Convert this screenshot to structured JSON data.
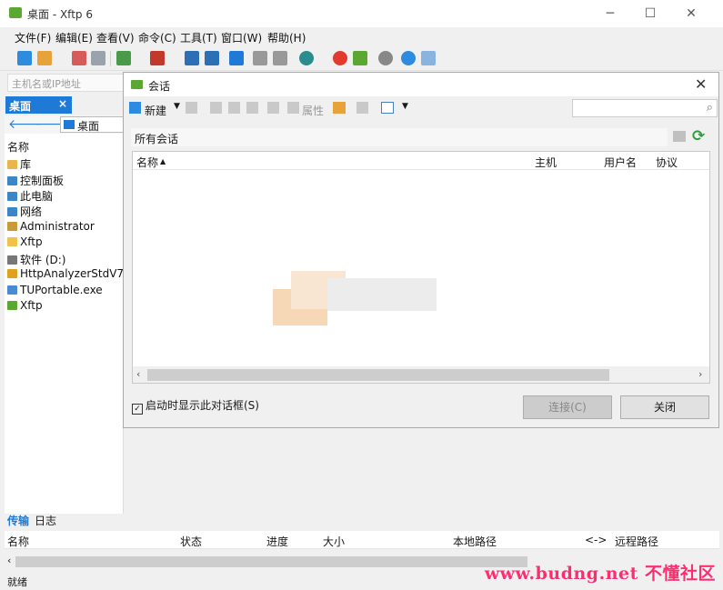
{
  "window": {
    "title": "桌面 - Xftp 6"
  },
  "menus": [
    "文件(F)",
    "编辑(E)",
    "查看(V)",
    "命令(C)",
    "工具(T)",
    "窗口(W)",
    "帮助(H)"
  ],
  "host_placeholder": "主机名或IP地址",
  "left_tab": {
    "label": "桌面",
    "close": "×"
  },
  "path": "桌面",
  "file_header": "名称",
  "files": [
    "库",
    "控制面板",
    "此电脑",
    "网络",
    "Administrator",
    "Xftp",
    "软件 (D:)",
    "HttpAnalyzerStdV7",
    "TUPortable.exe",
    "Xftp"
  ],
  "dialog": {
    "title": "会话",
    "new_label": "新建",
    "properties_label": "属性",
    "breadcrumb": "所有会话",
    "columns": [
      "名称",
      "主机",
      "用户名",
      "协议"
    ],
    "startup_checkbox": "启动时显示此对话框(S)",
    "connect_label": "连接(C)",
    "close_label": "关闭"
  },
  "bottom": {
    "tabs": [
      "传输",
      "日志"
    ],
    "columns": [
      "名称",
      "状态",
      "进度",
      "大小",
      "本地路径",
      "<->",
      "远程路径"
    ],
    "status": "就绪"
  },
  "watermark": "www.budng.net 不懂社区",
  "colors": {
    "accent": "#1e7ad6",
    "brand": "#5aa832",
    "watermark": "#ff2d6e"
  }
}
